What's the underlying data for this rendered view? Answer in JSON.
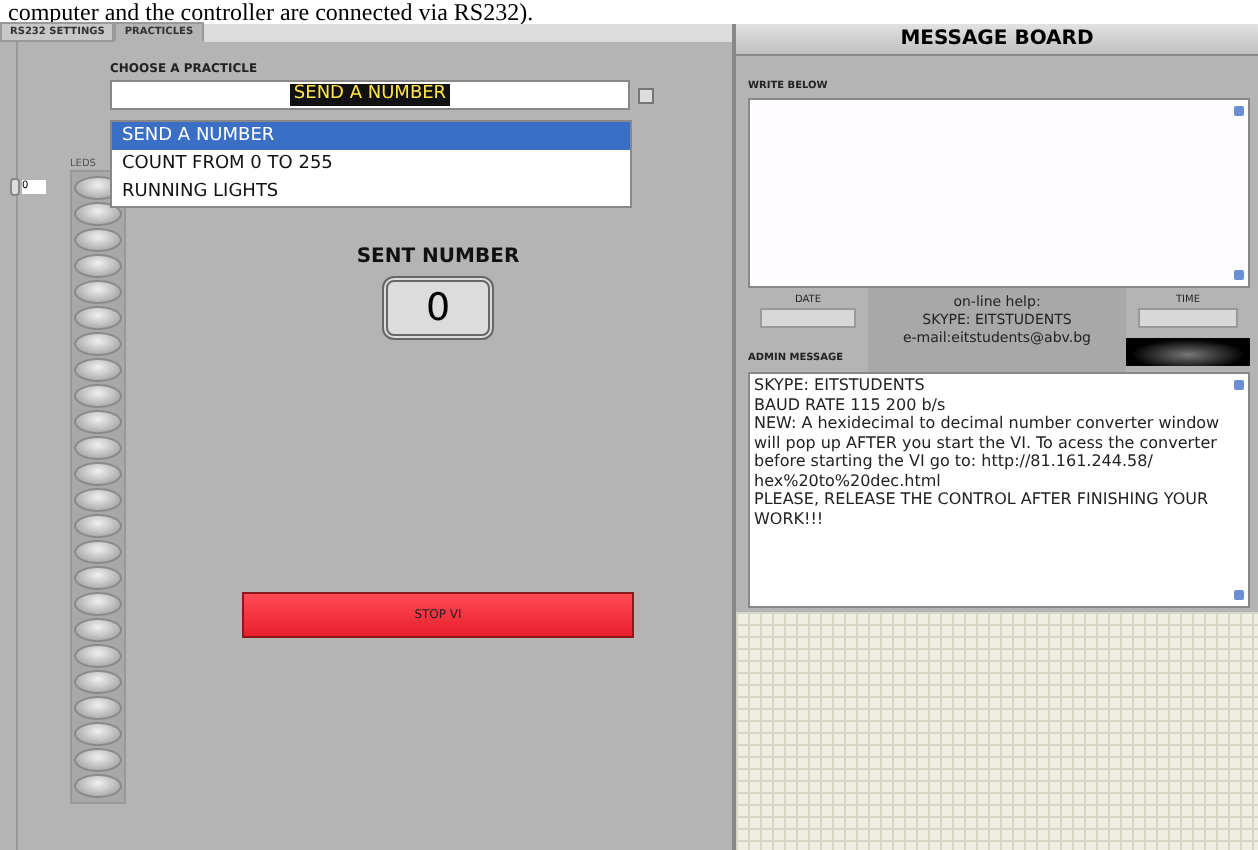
{
  "caption": "computer and the controller are connected via RS232).",
  "tabs": [
    {
      "label": "RS232 SETTINGS",
      "selected": false
    },
    {
      "label": "PRACTICLES",
      "selected": true
    }
  ],
  "practice": {
    "label": "CHOOSE A PRACTICLE",
    "value": "SEND A NUMBER",
    "options": [
      {
        "label": "SEND A NUMBER",
        "selected": true
      },
      {
        "label": "COUNT FROM 0 TO 255",
        "selected": false
      },
      {
        "label": "RUNNING LIGHTS",
        "selected": false
      }
    ]
  },
  "leds": {
    "label": "LEDS",
    "index": "0",
    "items": [
      {
        "on": false
      },
      {
        "on": false
      },
      {
        "on": false
      },
      {
        "on": false
      },
      {
        "on": false
      },
      {
        "on": false
      },
      {
        "on": false
      },
      {
        "on": false
      },
      {
        "on": false
      },
      {
        "on": false
      },
      {
        "on": false
      },
      {
        "on": false
      },
      {
        "on": false
      },
      {
        "on": false
      },
      {
        "on": false
      },
      {
        "on": false
      },
      {
        "on": false
      },
      {
        "on": false
      },
      {
        "on": false
      },
      {
        "on": false
      },
      {
        "on": false
      },
      {
        "on": false
      },
      {
        "on": false
      },
      {
        "on": false
      }
    ]
  },
  "sent_number": {
    "label": "SENT NUMBER",
    "value": "0"
  },
  "stop_button": "STOP VI",
  "message_board": {
    "title": "MESSAGE BOARD",
    "write_label": "WRITE BELOW",
    "date_label": "DATE",
    "time_label": "TIME",
    "help": [
      "on-line help:",
      "SKYPE: EITSTUDENTS",
      "e-mail:eitstudents@abv.bg"
    ],
    "admin_label": "ADMIN MESSAGE",
    "admin_message": "SKYPE: EITSTUDENTS\nBAUD RATE 115 200 b/s\nNEW: A hexidecimal to decimal number converter window will pop up AFTER you start the VI. To acess the converter before starting the VI go to: http://81.161.244.58/\nhex%20to%20dec.html\nPLEASE, RELEASE THE CONTROL AFTER FINISHING YOUR WORK!!!"
  }
}
